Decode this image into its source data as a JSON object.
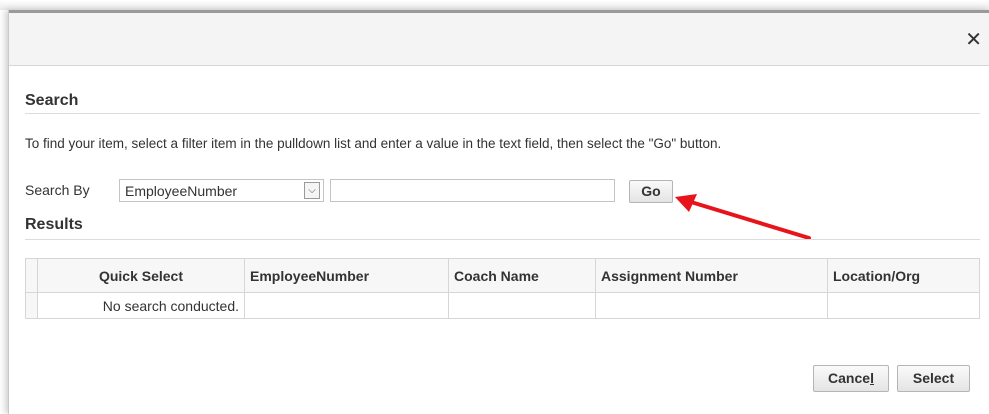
{
  "dialog": {
    "close_icon": "close-icon"
  },
  "search": {
    "heading": "Search",
    "instructions": "To find your item, select a filter item in the pulldown list and enter a value in the text field, then select the \"Go\" button.",
    "search_by_label": "Search By",
    "filter_selected": "EmployeeNumber",
    "text_value": "",
    "go_label": "Go"
  },
  "results": {
    "heading": "Results",
    "columns": [
      "Quick Select",
      "EmployeeNumber",
      "Coach Name",
      "Assignment Number",
      "Location/Org"
    ],
    "empty_message": "No search conducted."
  },
  "footer": {
    "cancel_pre": "Cance",
    "cancel_mnemonic": "l",
    "select_label": "Select"
  },
  "annotation": {
    "arrow_color": "#e8141b"
  }
}
